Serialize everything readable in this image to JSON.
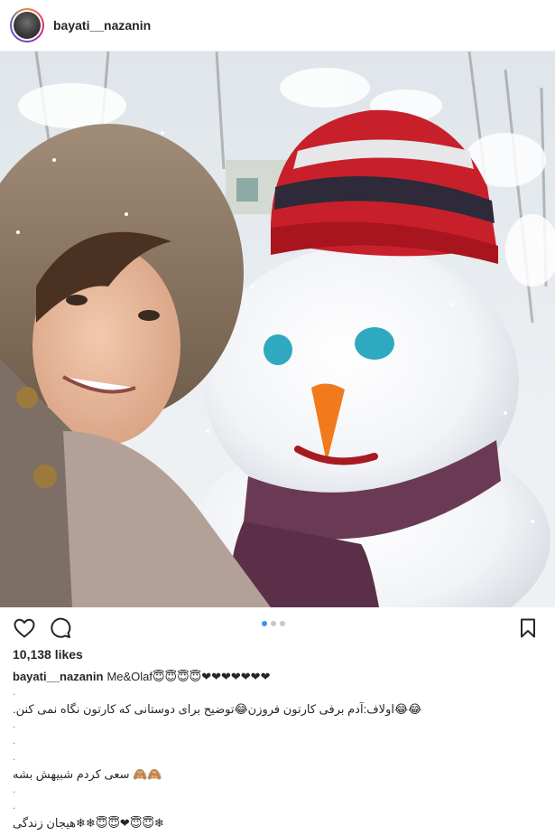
{
  "header": {
    "username": "bayati__nazanin"
  },
  "photo": {
    "alt_icon": "selfie-with-snowman-photo"
  },
  "actions": {
    "like_icon": "heart-icon",
    "comment_icon": "comment-icon",
    "save_icon": "bookmark-icon",
    "carousel": {
      "count": 3,
      "active_index": 0
    }
  },
  "likes": {
    "text": "10,138 likes"
  },
  "caption": {
    "username": "bayati__nazanin",
    "first_line": "Me&Olaf😇😇😇😇❤❤❤❤❤❤❤",
    "lines": [
      ".",
      "😂😂اولاف:آدم برفی کارتون فروزن😂توضیح برای دوستانی که کارتون نگاه نمی کنن.",
      ".",
      ".",
      ".",
      "🙈🙈 سعی کردم شبیهش بشه ",
      ".",
      ".",
      "❄😇😇❤😇😇❄❄هیجان زندگی"
    ]
  },
  "colors": {
    "accent": "#3897f0",
    "text": "#262626",
    "dot_inactive": "#c7c7c7"
  }
}
